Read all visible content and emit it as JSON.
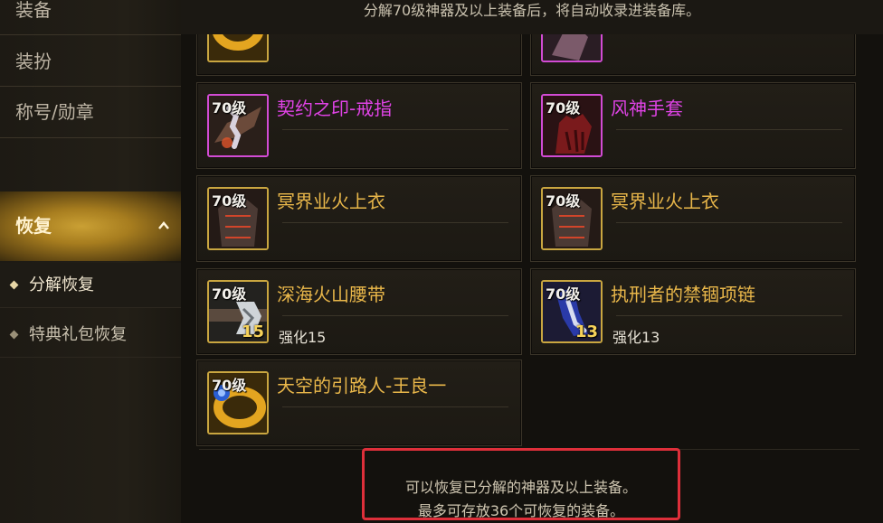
{
  "sidebar": {
    "items": [
      {
        "label": "装备"
      },
      {
        "label": "装扮"
      },
      {
        "label": "称号/勋章"
      },
      {
        "label": "恢复"
      }
    ],
    "sub_items": [
      {
        "label": "分解恢复"
      },
      {
        "label": "特典礼包恢复"
      }
    ]
  },
  "banner": {
    "text": "分解70级神器及以上装备后，将自动收录进装备库。"
  },
  "cards": [
    {
      "level": "70级",
      "name": "契约之印-戒指",
      "rarity_color": "#e043e6"
    },
    {
      "level": "70级",
      "name": "风神手套",
      "rarity_color": "#e043e6"
    },
    {
      "level": "70级",
      "name": "冥界业火上衣",
      "rarity_color": "#e9b74a"
    },
    {
      "level": "70级",
      "name": "冥界业火上衣",
      "rarity_color": "#e9b74a"
    },
    {
      "level": "70级",
      "name": "深海火山腰带",
      "enhance": "强化15",
      "enhance_num": "15",
      "rarity_color": "#e9b74a"
    },
    {
      "level": "70级",
      "name": "执刑者的禁锢项链",
      "enhance": "强化13",
      "enhance_num": "13",
      "rarity_color": "#e9b74a"
    },
    {
      "level": "70级",
      "name": "天空的引路人-王良一",
      "rarity_color": "#e9b74a"
    }
  ],
  "info": {
    "line1": "可以恢复已分解的神器及以上装备。",
    "line2": "最多可存放36个可恢复的装备。"
  }
}
